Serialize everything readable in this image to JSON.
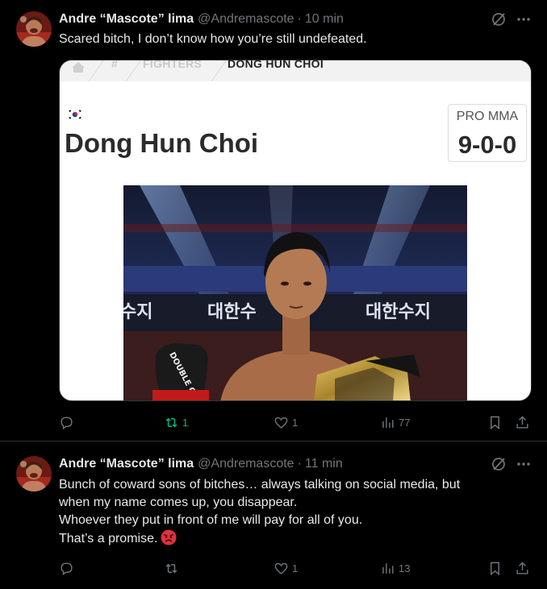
{
  "tweets": [
    {
      "author_name": "Andre “Mascote” lima",
      "handle": "@Andremascote",
      "separator": "·",
      "time": "10 min",
      "lines": [
        "Scared bitch, I don’t know how you’re still undefeated."
      ],
      "media": {
        "breadcrumb": [
          "#",
          "FIGHTERS",
          "DONG HUN CHOI"
        ],
        "fighter_name": "Dong Hun Choi",
        "record_label": "PRO MMA",
        "record_value": "9-0-0",
        "banner_text_left": "수지",
        "banner_text_mid": "대한수",
        "banner_text_right": "대한수지",
        "glove_text": "DOUBLE G"
      },
      "stats": {
        "replies": "",
        "retweets": "1",
        "likes": "1",
        "views": "77"
      },
      "retweeted": true
    },
    {
      "author_name": "Andre “Mascote” lima",
      "handle": "@Andremascote",
      "separator": "·",
      "time": "11 min",
      "lines": [
        "Bunch of coward sons of bitches… always talking on social media, but",
        "when my name comes up, you disappear.",
        "Whoever they put in front of me will pay for all of you.",
        "That’s a promise."
      ],
      "emoji": "angry-face-emoji",
      "stats": {
        "replies": "",
        "retweets": "",
        "likes": "1",
        "views": "13"
      },
      "retweeted": false
    }
  ],
  "colors": {
    "background": "#000000",
    "text": "#e7e9ea",
    "muted": "#71767b",
    "divider": "#2f3336",
    "retweet_active": "#00ba7c"
  }
}
